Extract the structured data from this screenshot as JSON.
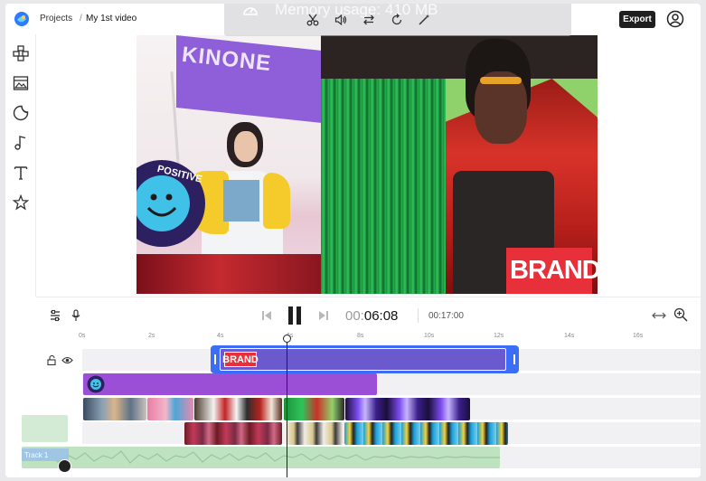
{
  "header": {
    "breadcrumb_projects": "Projects",
    "breadcrumb_separator": "/",
    "project_title": "My 1st video",
    "export_label": "Export"
  },
  "overlay": {
    "memory_usage": "Memory usage: 410 MB"
  },
  "toolbar_icons": [
    "cut-icon",
    "volume-icon",
    "swap-icon",
    "rotate-icon",
    "magic-wand-icon"
  ],
  "sidebar_icons": [
    "elements-icon",
    "media-icon",
    "stickers-icon",
    "music-icon",
    "text-icon",
    "effects-star-icon"
  ],
  "preview": {
    "left_flag_text": "KINONE",
    "sticker_text": "POSITIVE VIBES",
    "brand_text": "BRAND"
  },
  "playback": {
    "current_time_dim": "00:",
    "current_time": "06:08",
    "total_time": "00:17:00"
  },
  "ruler": {
    "labels": [
      "0s",
      "2s",
      "4s",
      "6s",
      "8s",
      "10s",
      "12s",
      "14s",
      "16s"
    ]
  },
  "timeline": {
    "text_clip_label": "BRAND",
    "audio_track_label": "Track 1"
  },
  "colors": {
    "accent_blue": "#3b6ef5",
    "text_clip_purple": "#6a5acd",
    "sticker_clip_purple": "#9b4fd6",
    "audio_green": "#bfe3c0",
    "preview_green": "#8fd16a",
    "brand_red": "#e8303a"
  }
}
